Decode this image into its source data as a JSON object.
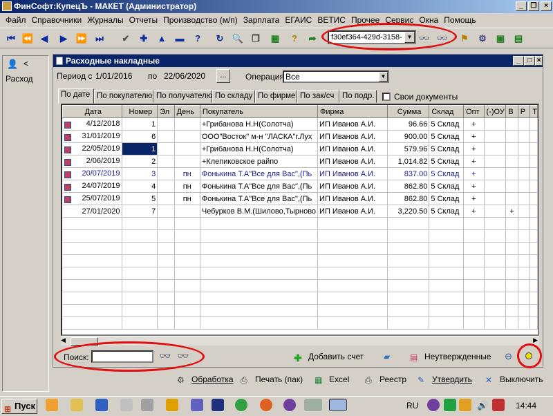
{
  "window": {
    "title": "ФинСофт:КупецЪ - МАКЕТ  (Администратор)"
  },
  "menu": [
    "Файл",
    "Справочники",
    "Журналы",
    "Отчеты",
    "Производство (м/п)",
    "Зарплата",
    "ЕГАИС",
    "ВЕТИС",
    "Прочее",
    "Сервис",
    "Окна",
    "Помощь"
  ],
  "toolbar": {
    "doc_id": "f30ef364-429d-3158-"
  },
  "left_panel": {
    "label": "Расход"
  },
  "child": {
    "title": "Расходные накладные",
    "period_label": "Период с",
    "period_from": "1/01/2016",
    "period_to_label": "по",
    "period_to": "22/06/2020",
    "ellipsis": "...",
    "operation_label": "Операция:",
    "operation_value": "Все"
  },
  "tabs": [
    "По дате",
    "По покупателю",
    "По получателю",
    "По складу",
    "По фирме",
    "По зак/сч",
    "По подр."
  ],
  "own_docs_label": "Свои документы",
  "columns": [
    "Дата",
    "Номер",
    "Эл",
    "День",
    "Покупатель",
    "Фирма",
    "Сумма",
    "Склад",
    "Опт",
    "(-)ОУ",
    "В",
    "Р",
    "Т"
  ],
  "rows": [
    {
      "checked": true,
      "date": "4/12/2018",
      "num": "1",
      "el": "",
      "day": "",
      "buyer": "+Грибанова  Н.Н(Солотча)",
      "firm": "ИП Иванов А.И.",
      "sum": "96.66",
      "store": "5 Склад",
      "opt": "+",
      "ou": "",
      "v": "",
      "r": "",
      "blue": false
    },
    {
      "checked": true,
      "date": "31/01/2019",
      "num": "6",
      "el": "",
      "day": "",
      "buyer": "ООО\"Восток\" м-н \"ЛАСКА\"г.Лух",
      "firm": "ИП Иванов А.И.",
      "sum": "900.00",
      "store": "5 Склад",
      "opt": "+",
      "ou": "",
      "v": "",
      "r": "",
      "blue": false
    },
    {
      "checked": true,
      "date": "22/05/2019",
      "num": "1",
      "el": "",
      "day": "",
      "buyer": "+Грибанова  Н.Н(Солотча)",
      "firm": "ИП Иванов А.И.",
      "sum": "579.96",
      "store": "5 Склад",
      "opt": "+",
      "ou": "",
      "v": "",
      "r": "",
      "blue": false,
      "selected": true
    },
    {
      "checked": true,
      "date": "2/06/2019",
      "num": "2",
      "el": "",
      "day": "",
      "buyer": "+Клепиковское райпо",
      "firm": "ИП Иванов А.И.",
      "sum": "1,014.82",
      "store": "5 Склад",
      "opt": "+",
      "ou": "",
      "v": "",
      "r": "",
      "blue": false
    },
    {
      "checked": true,
      "date": "20/07/2019",
      "num": "3",
      "el": "",
      "day": "пн",
      "buyer": "Фонькина Т.А\"Все для Вас\",(Пь",
      "firm": "ИП Иванов А.И.",
      "sum": "837.00",
      "store": "5 Склад",
      "opt": "+",
      "ou": "",
      "v": "",
      "r": "",
      "blue": true
    },
    {
      "checked": true,
      "date": "24/07/2019",
      "num": "4",
      "el": "",
      "day": "пн",
      "buyer": "Фонькина Т.А\"Все для Вас\",(Пь",
      "firm": "ИП Иванов А.И.",
      "sum": "862.80",
      "store": "5 Склад",
      "opt": "+",
      "ou": "",
      "v": "",
      "r": "",
      "blue": false
    },
    {
      "checked": true,
      "date": "25/07/2019",
      "num": "5",
      "el": "",
      "day": "пн",
      "buyer": "Фонькина Т.А\"Все для Вас\",(Пь",
      "firm": "ИП Иванов А.И.",
      "sum": "862.80",
      "store": "5 Склад",
      "opt": "+",
      "ou": "",
      "v": "",
      "r": "",
      "blue": false
    },
    {
      "checked": false,
      "date": "27/01/2020",
      "num": "7",
      "el": "",
      "day": "",
      "buyer": "Чебурков В.М.(Шилово,Тырново",
      "firm": "ИП Иванов А.И.",
      "sum": "3,220.50",
      "store": "5 Склад",
      "opt": "+",
      "ou": "",
      "v": "+",
      "r": "",
      "blue": false
    }
  ],
  "search": {
    "label": "Поиск:",
    "value": ""
  },
  "actions": {
    "add_invoice": "Добавить счет",
    "unconfirmed": "Неутвержденные",
    "processing": "Обработка",
    "print": "Печать (пак)",
    "excel": "Excel",
    "registry": "Реестр",
    "approve": "Утвердить",
    "exit": "Выключить"
  },
  "taskbar": {
    "start": "Пуск",
    "lang": "RU",
    "clock": "14:44"
  }
}
